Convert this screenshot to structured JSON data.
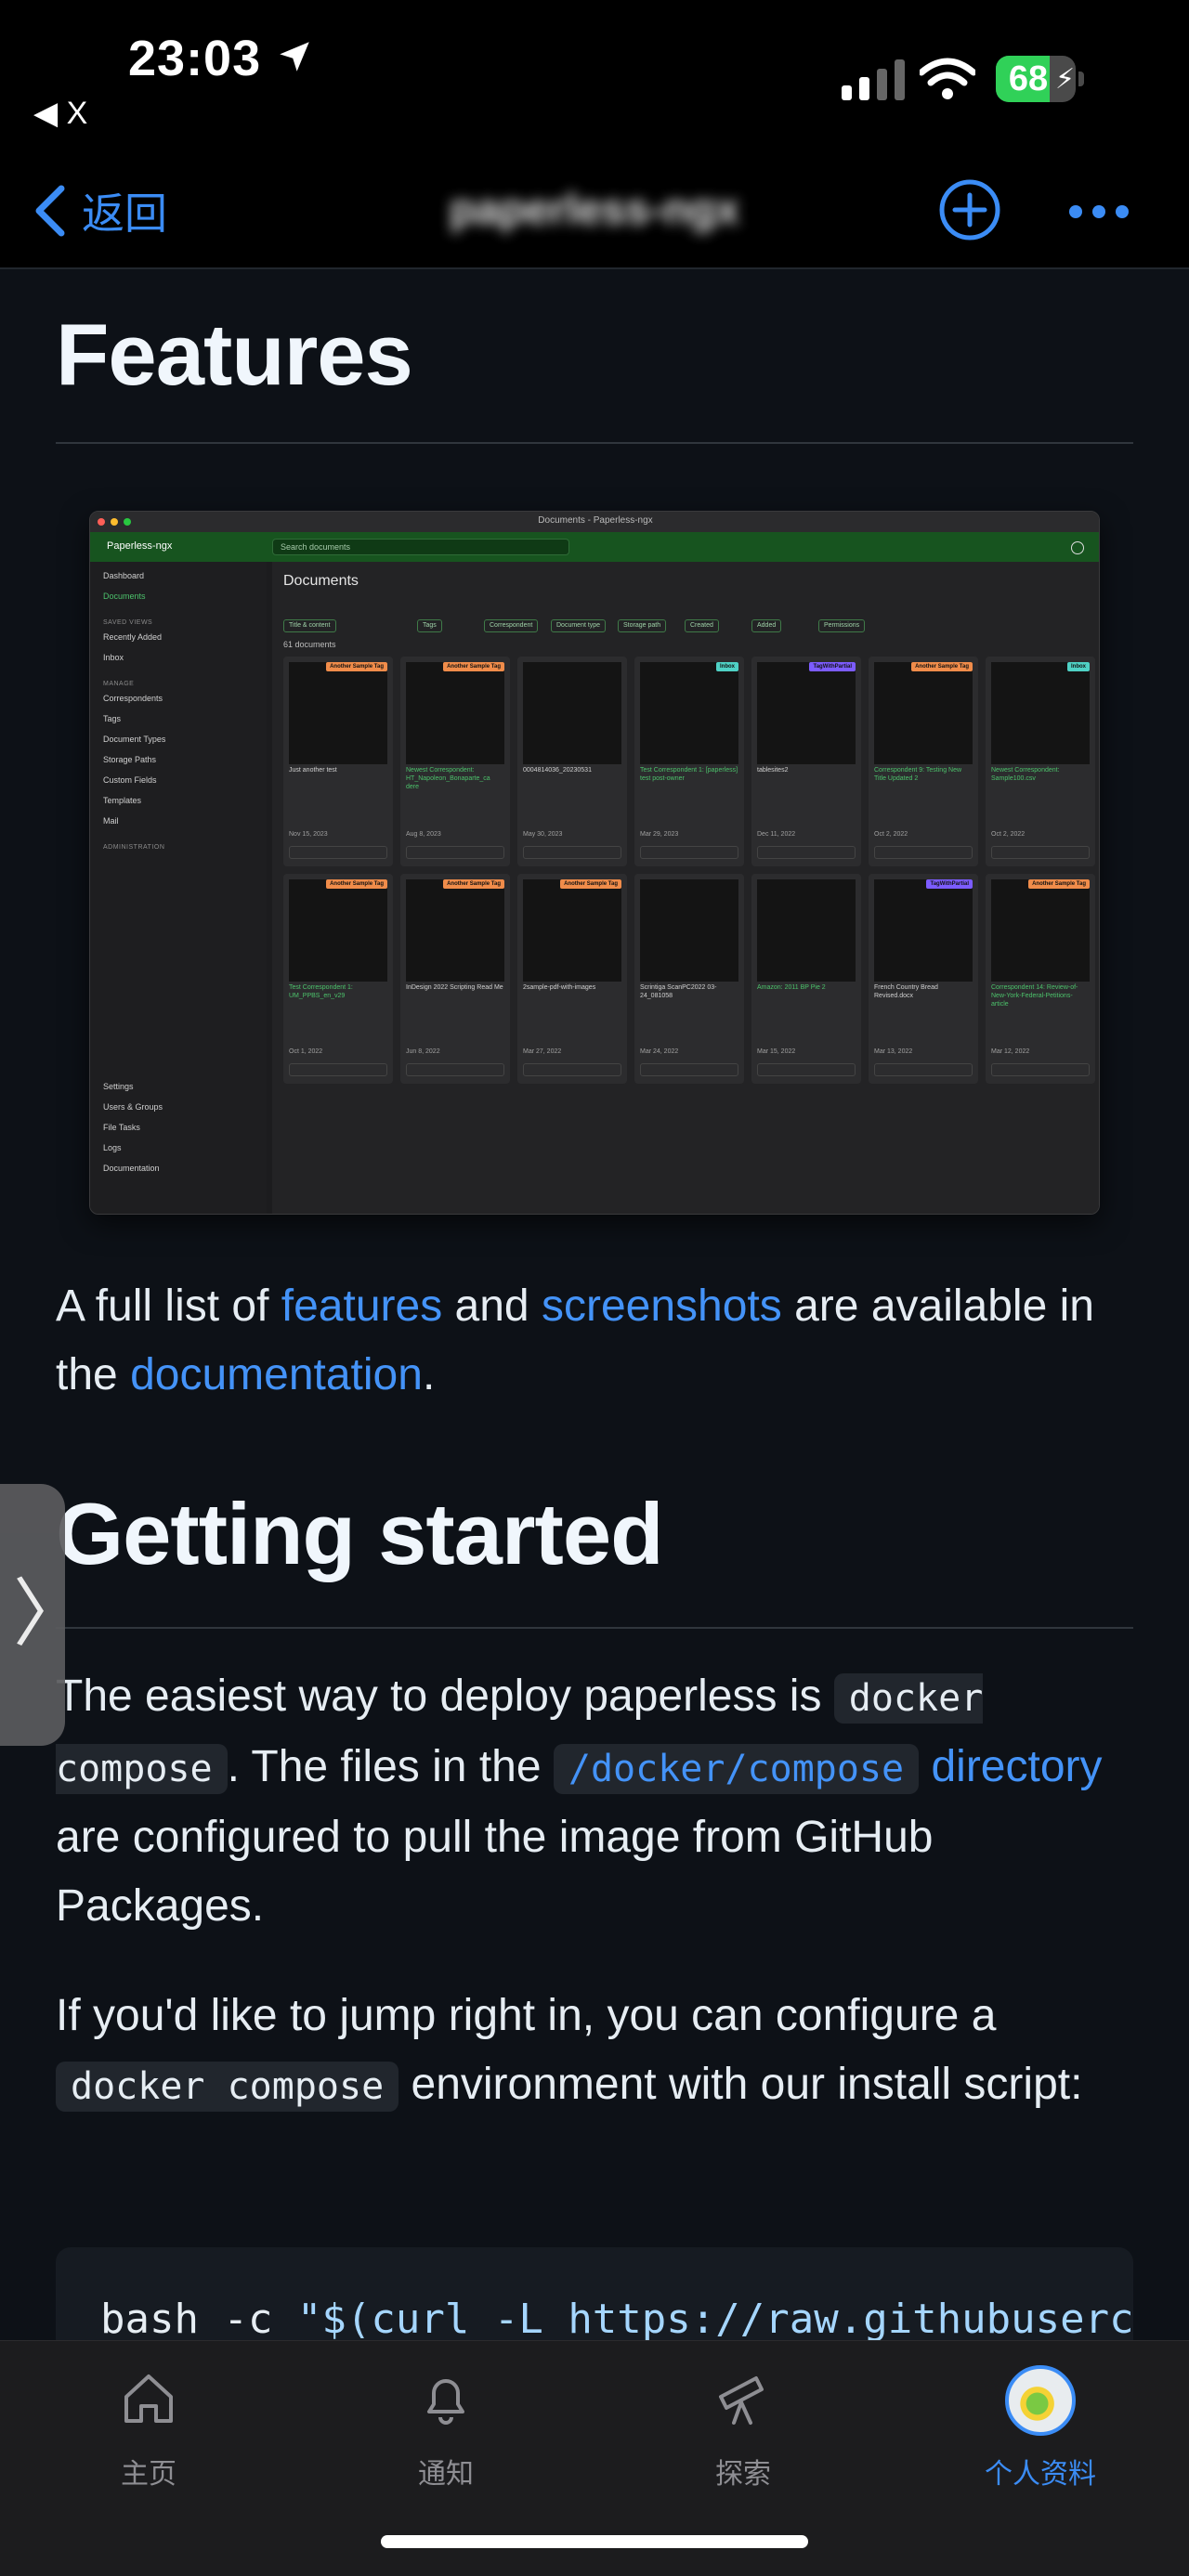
{
  "status_bar": {
    "time": "23:03",
    "back_app": "◀ X",
    "battery_percent": "68",
    "battery_level": 0.68
  },
  "nav": {
    "back_label": "返回",
    "title": "paperless-ngx"
  },
  "features": {
    "heading": "Features",
    "screenshot": {
      "window_title": "Documents - Paperless-ngx",
      "brand": "Paperless-ngx",
      "search_placeholder": "Search documents",
      "page_heading": "Documents",
      "doc_count": "61 documents",
      "sidebar": [
        {
          "label": "Dashboard",
          "active": false
        },
        {
          "label": "Documents",
          "active": true
        },
        {
          "label": "SAVED VIEWS",
          "head": true
        },
        {
          "label": "Recently Added",
          "active": false
        },
        {
          "label": "Inbox",
          "active": false
        },
        {
          "label": "MANAGE",
          "head": true
        },
        {
          "label": "Correspondents",
          "active": false
        },
        {
          "label": "Tags",
          "active": false
        },
        {
          "label": "Document Types",
          "active": false
        },
        {
          "label": "Storage Paths",
          "active": false
        },
        {
          "label": "Custom Fields",
          "active": false
        },
        {
          "label": "Templates",
          "active": false
        },
        {
          "label": "Mail",
          "active": false
        },
        {
          "label": "ADMINISTRATION",
          "head": true
        },
        {
          "label": "Settings",
          "active": false
        },
        {
          "label": "Users & Groups",
          "active": false
        },
        {
          "label": "File Tasks",
          "active": false
        },
        {
          "label": "Logs",
          "active": false
        },
        {
          "label": "Documentation",
          "active": false
        }
      ],
      "filters": [
        "Title & content",
        "Tags",
        "Correspondent",
        "Document type",
        "Storage path",
        "Created",
        "Added",
        "Permissions"
      ],
      "cards": [
        {
          "title": "Just another test",
          "date": "Nov 15, 2023",
          "green": false,
          "tag": "Another Sample Tag",
          "tag_color": "#f08c4a"
        },
        {
          "title": "Newest Correspondent: HT_Napoleon_Bonaparte_ca dere",
          "date": "Aug 8, 2023",
          "green": true,
          "tag": "Another Sample Tag",
          "tag_color": "#f08c4a"
        },
        {
          "title": "0004814036_20230531",
          "date": "May 30, 2023",
          "green": false,
          "tag": "",
          "tag_color": ""
        },
        {
          "title": "Test Correspondent 1: [paperless] test post-owner",
          "date": "Mar 29, 2023",
          "green": true,
          "tag": "Inbox",
          "tag_color": "#4fd1c5"
        },
        {
          "title": "tablesites2",
          "date": "Dec 11, 2022",
          "green": false,
          "tag": "TagWithPartial",
          "tag_color": "#7c5cff"
        },
        {
          "title": "Correspondent 9: Testing New Title Updated 2",
          "date": "Oct 2, 2022",
          "green": true,
          "tag": "Another Sample Tag",
          "tag_color": "#f08c4a"
        },
        {
          "title": "Newest Correspondent: Sample100.csv",
          "date": "Oct 2, 2022",
          "green": true,
          "tag": "Inbox",
          "tag_color": "#4fd1c5"
        },
        {
          "title": "Test Correspondent 1: UM_PPBS_en_v29",
          "date": "Oct 1, 2022",
          "green": true,
          "tag": "Another Sample Tag",
          "tag_color": "#f08c4a"
        },
        {
          "title": "InDesign 2022 Scripting Read Me",
          "date": "Jun 8, 2022",
          "green": false,
          "tag": "Another Sample Tag",
          "tag_color": "#f08c4a"
        },
        {
          "title": "2sample-pdf-with-images",
          "date": "Mar 27, 2022",
          "green": false,
          "tag": "Another Sample Tag",
          "tag_color": "#f08c4a"
        },
        {
          "title": "Scrintiga ScanPC2022 03-24_081058",
          "date": "Mar 24, 2022",
          "green": false,
          "tag": "",
          "tag_color": ""
        },
        {
          "title": "Amazon: 2011 BP Pie 2",
          "date": "Mar 15, 2022",
          "green": true,
          "tag": "",
          "tag_color": ""
        },
        {
          "title": "French Country Bread Revised.docx",
          "date": "Mar 13, 2022",
          "green": false,
          "tag": "TagWithPartial",
          "tag_color": "#7c5cff"
        },
        {
          "title": "Correspondent 14: Review-of-New-York-Federal-Petitions-article",
          "date": "Mar 12, 2022",
          "green": true,
          "tag": "Another Sample Tag",
          "tag_color": "#f08c4a"
        }
      ]
    }
  },
  "features_para": {
    "t1": "A full list of ",
    "link_features": "features",
    "t2": " and ",
    "link_screenshots": "screenshots",
    "t3": " are available in the ",
    "link_documentation": "documentation",
    "t4": "."
  },
  "getting_started": {
    "heading": "Getting started",
    "p1": {
      "t1": "The easiest way to deploy paperless is ",
      "code1": "docker compose",
      "t2": ". The files in the ",
      "link_code": "/docker/compose",
      "link_text": " directory",
      "t3": " are configured to pull the image from GitHub Packages."
    },
    "p2": {
      "t1": "If you'd like to jump right in, you can configure a ",
      "code1": "docker compose",
      "t2": " environment with our install script:"
    },
    "code_cmd": "bash -c ",
    "code_str": "\"$(curl -L https://raw.githubuserc"
  },
  "tabbar": {
    "items": [
      {
        "label": "主页",
        "icon": "home-icon"
      },
      {
        "label": "通知",
        "icon": "bell-icon"
      },
      {
        "label": "探索",
        "icon": "telescope-icon"
      },
      {
        "label": "个人资料",
        "icon": "avatar"
      }
    ]
  },
  "colors": {
    "accent": "#3b8cf5",
    "link": "#4493f8",
    "background": "#0d1117",
    "paperless_green": "#17541f"
  }
}
